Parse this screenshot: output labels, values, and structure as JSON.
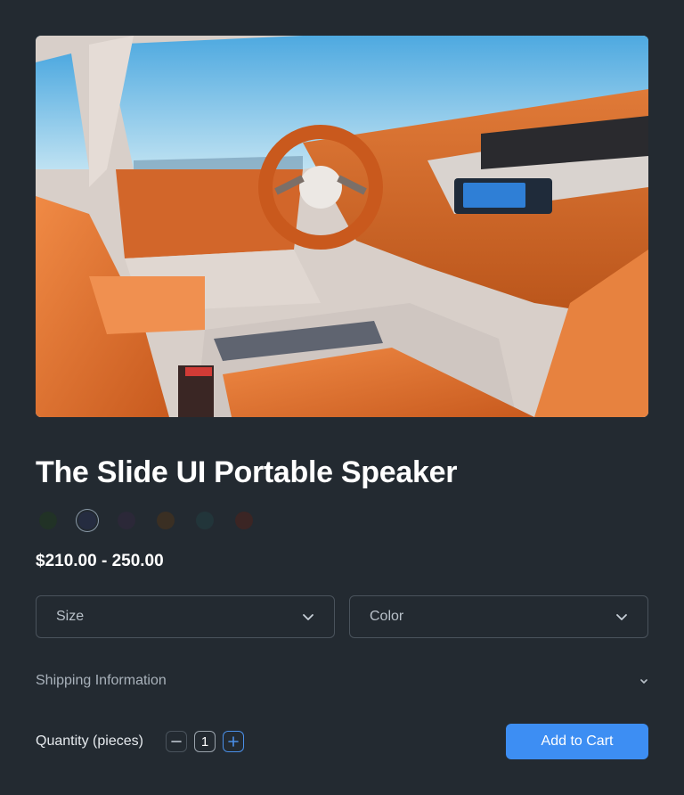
{
  "product": {
    "image_alt": "Car interior with orange leather seats",
    "title": "The Slide UI Portable Speaker",
    "price": "$210.00 - 250.00",
    "swatches": [
      {
        "color": "#213226",
        "selected": false
      },
      {
        "color": "#252c40",
        "selected": true
      },
      {
        "color": "#2b2838",
        "selected": false
      },
      {
        "color": "#3a2f23",
        "selected": false
      },
      {
        "color": "#22353a",
        "selected": false
      },
      {
        "color": "#3b2524",
        "selected": false
      }
    ]
  },
  "selects": {
    "size_label": "Size",
    "color_label": "Color"
  },
  "shipping": {
    "label": "Shipping Information"
  },
  "quantity": {
    "label": "Quantity (pieces)",
    "value": "1"
  },
  "cart": {
    "button_label": "Add to Cart"
  },
  "colors": {
    "background": "#232a31",
    "accent": "#3d8ef3",
    "border": "#4a535c"
  }
}
